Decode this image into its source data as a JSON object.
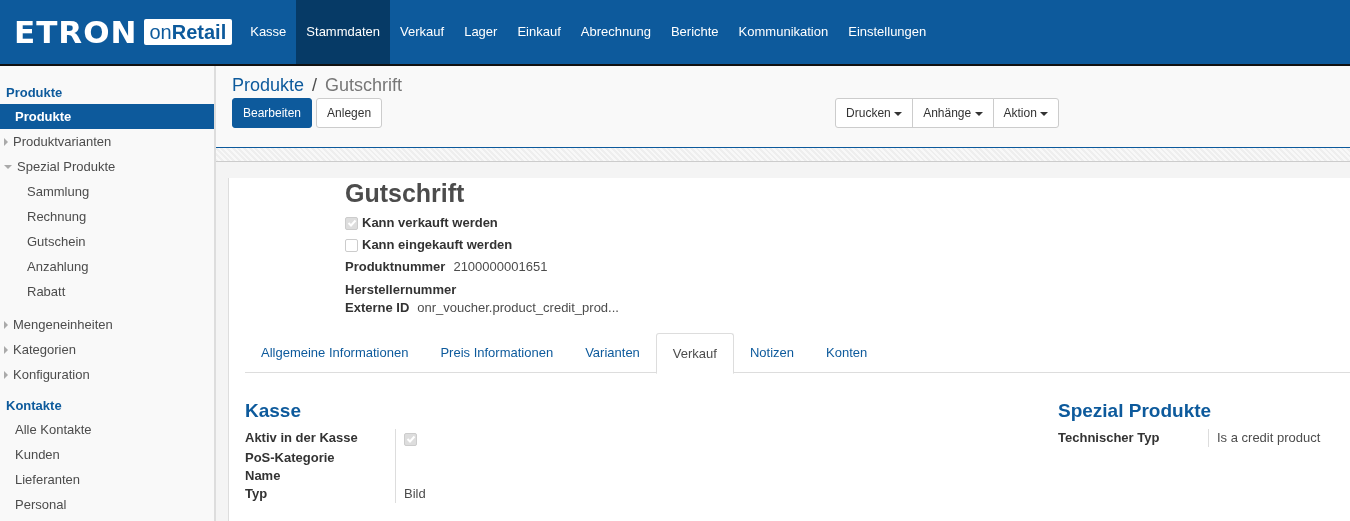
{
  "logo": {
    "brand": "ETRON",
    "product": "on**Retail**"
  },
  "menu": [
    {
      "label": "Kasse",
      "selected": false
    },
    {
      "label": "Stammdaten",
      "selected": true
    },
    {
      "label": "Verkauf",
      "selected": false
    },
    {
      "label": "Lager",
      "selected": false
    },
    {
      "label": "Einkauf",
      "selected": false
    },
    {
      "label": "Abrechnung",
      "selected": false
    },
    {
      "label": "Berichte",
      "selected": false
    },
    {
      "label": "Kommunikation",
      "selected": false
    },
    {
      "label": "Einstellungen",
      "selected": false
    }
  ],
  "sidebar": [
    {
      "heading": "Produkte",
      "items": [
        {
          "label": "Produkte",
          "kind": "link",
          "selected": true
        },
        {
          "label": "Produktvarianten",
          "kind": "folder",
          "expanded": false,
          "selected": false
        },
        {
          "label": "Spezial Produkte",
          "kind": "folder",
          "expanded": true,
          "selected": false,
          "children": [
            {
              "label": "Sammlung",
              "selected": false
            },
            {
              "label": "Rechnung",
              "selected": false
            },
            {
              "label": "Gutschein",
              "selected": false
            },
            {
              "label": "Anzahlung",
              "selected": false
            },
            {
              "label": "Rabatt",
              "selected": false
            }
          ]
        },
        {
          "label": "Mengeneinheiten",
          "kind": "folder",
          "expanded": false,
          "selected": false
        },
        {
          "label": "Kategorien",
          "kind": "folder",
          "expanded": false,
          "selected": false
        },
        {
          "label": "Konfiguration",
          "kind": "folder",
          "expanded": false,
          "selected": false
        }
      ]
    },
    {
      "heading": "Kontakte",
      "items": [
        {
          "label": "Alle Kontakte",
          "kind": "link",
          "selected": false
        },
        {
          "label": "Kunden",
          "kind": "link",
          "selected": false
        },
        {
          "label": "Lieferanten",
          "kind": "link",
          "selected": false
        },
        {
          "label": "Personal",
          "kind": "link",
          "selected": false
        }
      ]
    }
  ],
  "breadcrumb": {
    "parent": "Produkte",
    "separator": "/",
    "current": "Gutschrift"
  },
  "buttons": [
    {
      "label": "Bearbeiten",
      "primary": true
    },
    {
      "label": "Anlegen",
      "primary": false
    }
  ],
  "dropdowns": [
    "Drucken",
    "Anhänge",
    "Aktion"
  ],
  "form": {
    "title": "Gutschrift",
    "flags": [
      {
        "label": "Kann verkauft werden",
        "checked": true
      },
      {
        "label": "Kann eingekauft werden",
        "checked": false
      }
    ],
    "fields": [
      {
        "label": "Produktnummer",
        "value": "2100000001651"
      },
      {
        "label": "Herstellernummer"
      },
      {
        "label": "Externe ID",
        "value": "onr_voucher.product_credit_prod..."
      }
    ],
    "tabs": [
      {
        "label": "Allgemeine Informationen",
        "selected": false
      },
      {
        "label": "Preis Informationen",
        "selected": false
      },
      {
        "label": "Varianten",
        "selected": false
      },
      {
        "label": "Verkauf",
        "selected": true
      },
      {
        "label": "Notizen",
        "selected": false
      },
      {
        "label": "Konten",
        "selected": false
      }
    ],
    "groups": [
      {
        "title": "Kasse",
        "rows": [
          {
            "label": "Aktiv in der Kasse",
            "kind": "checkbox",
            "checked": true
          },
          {
            "label": "PoS-Kategorie Name",
            "kind": "text"
          },
          {
            "label": "Typ",
            "kind": "text",
            "value": "Bild"
          }
        ]
      },
      {
        "title": "Spezial Produkte",
        "rows": [
          {
            "label": "Technischer Typ",
            "kind": "text",
            "value": "Is a credit product"
          }
        ]
      }
    ]
  }
}
